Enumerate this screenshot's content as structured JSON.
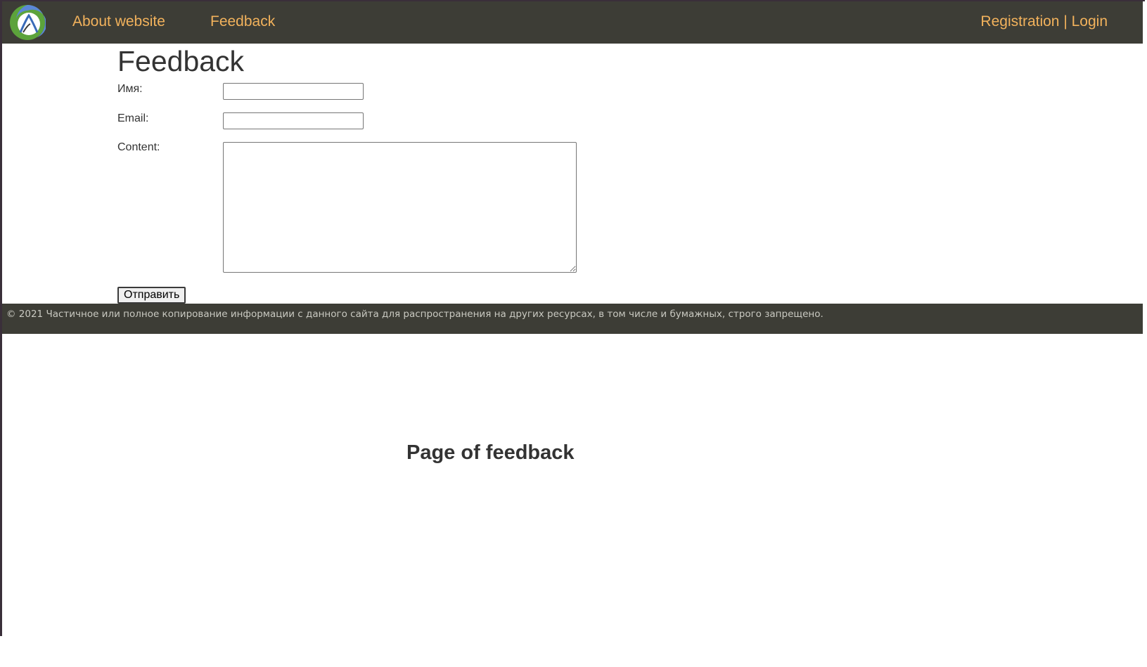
{
  "header": {
    "nav": {
      "about": "About website",
      "feedback": "Feedback"
    },
    "auth": {
      "registration": "Registration",
      "separator": " | ",
      "login": "Login"
    }
  },
  "main": {
    "title": "Feedback",
    "form": {
      "name_label": "Имя:",
      "name_value": "",
      "email_label": "Email:",
      "email_value": "",
      "content_label": "Content:",
      "content_value": "",
      "submit_label": "Отправить"
    }
  },
  "footer": {
    "text": "© 2021 Частичное или полное копирование информации с данного сайта для распространения на других ресурсах, в том числе и бумажных, строго запрещено."
  },
  "page_heading": "Page of feedback",
  "colors": {
    "header_bg": "#3d3d36",
    "link": "#f2b25c",
    "footer_text": "#c9c9c1"
  }
}
